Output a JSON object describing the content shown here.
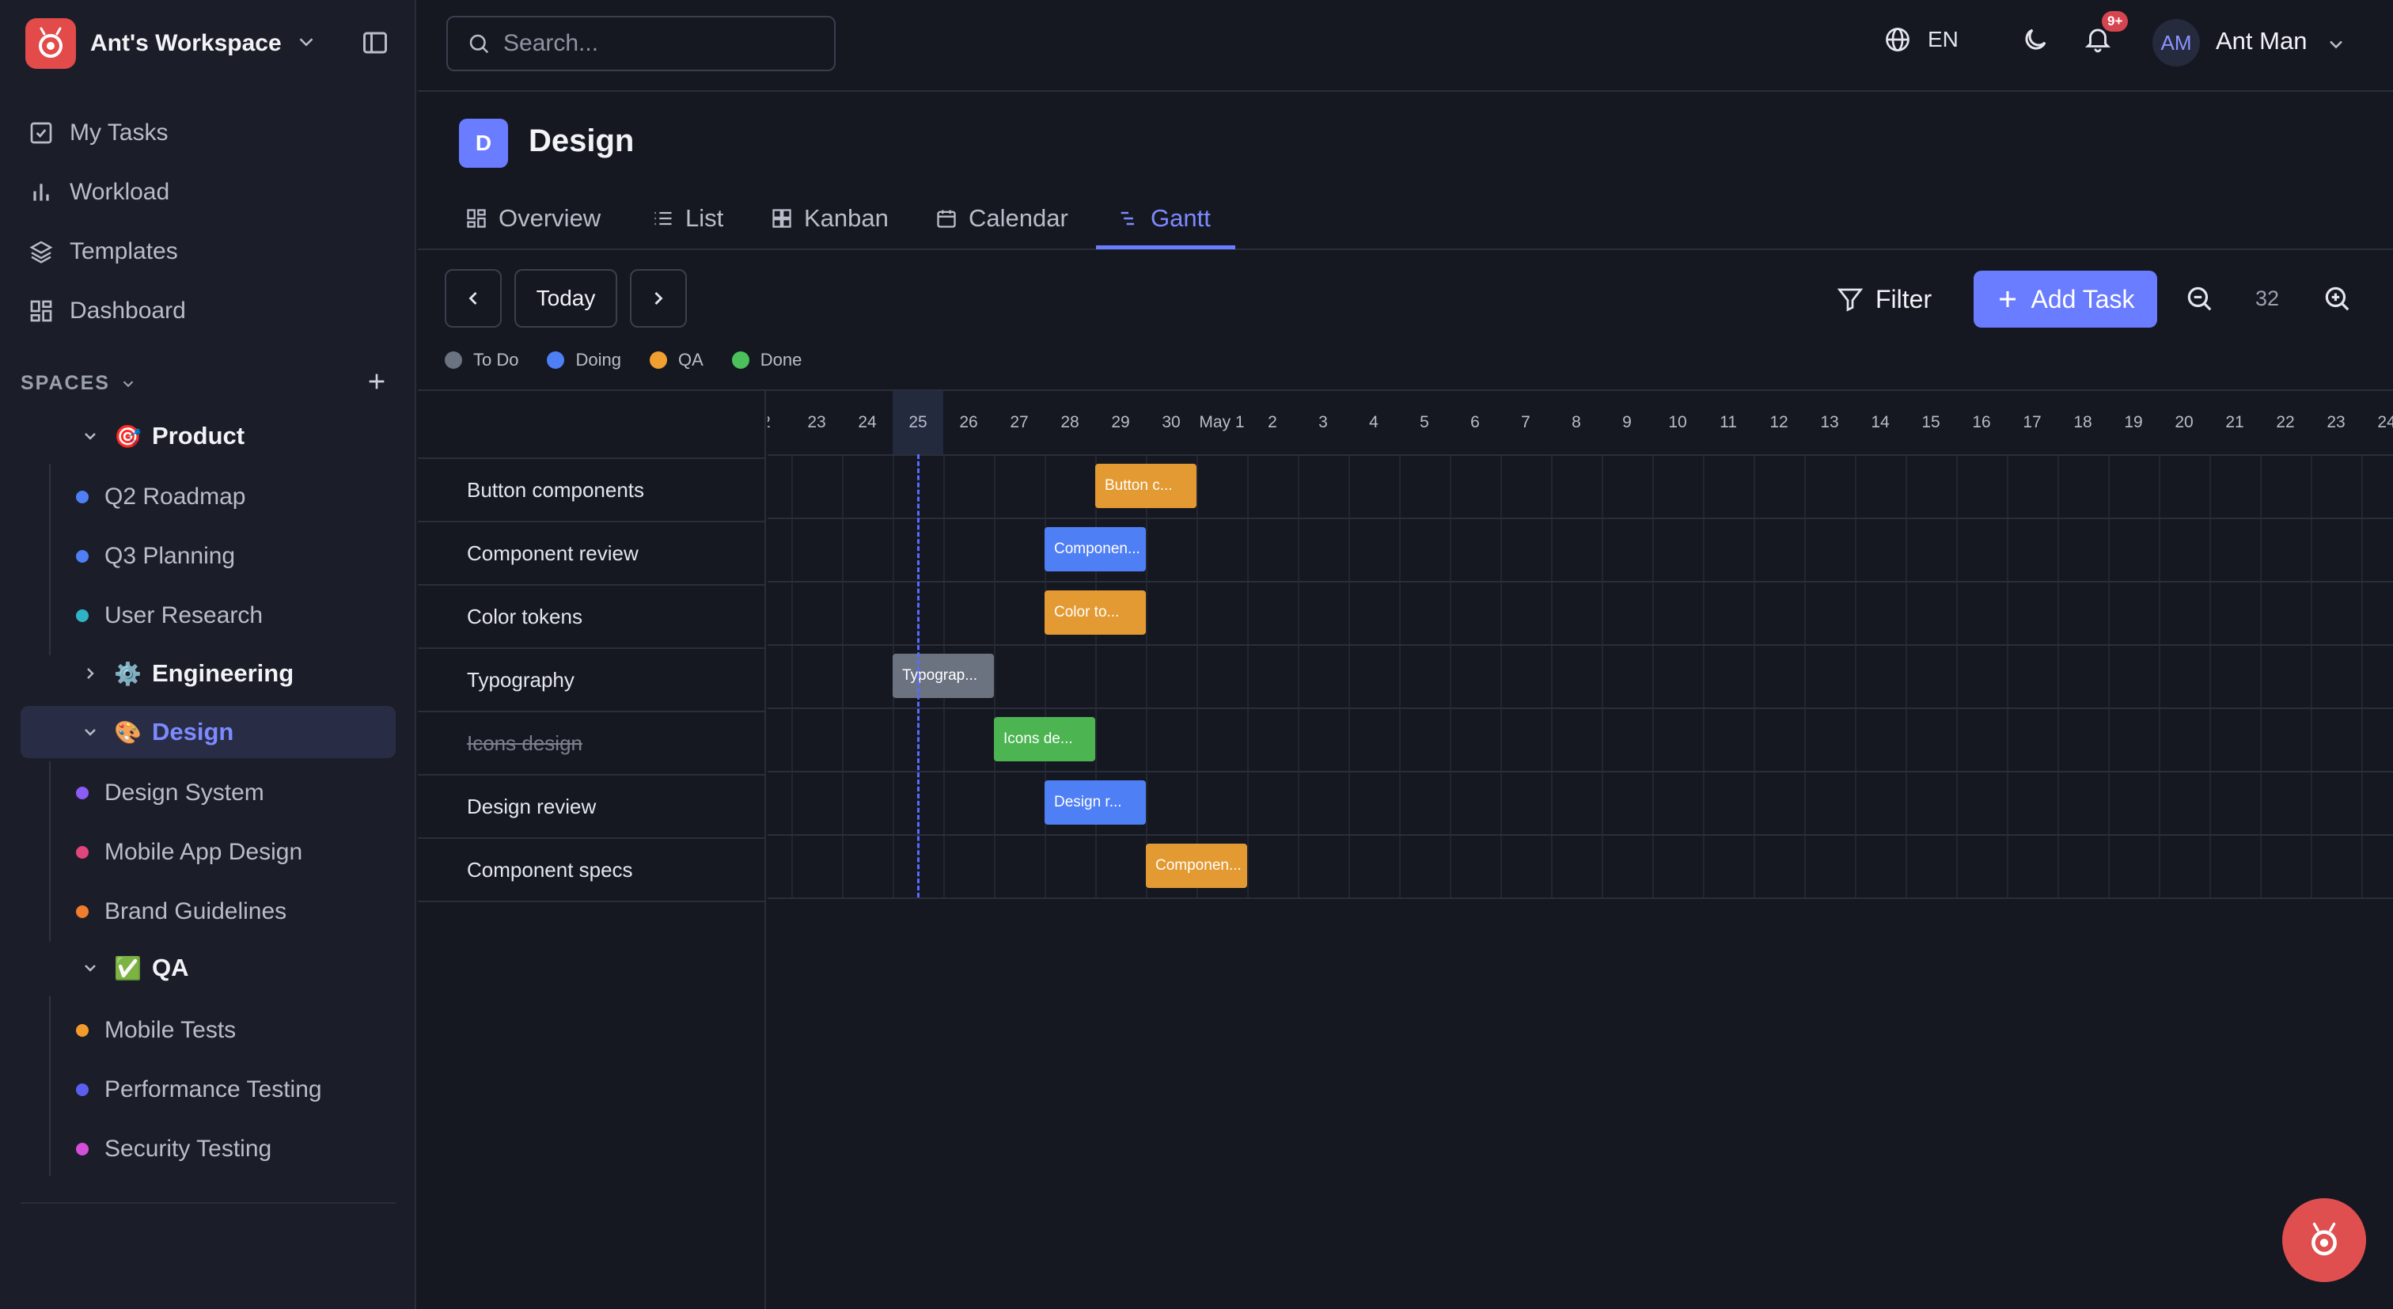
{
  "workspace": {
    "name": "Ant's Workspace"
  },
  "nav": [
    {
      "label": "My Tasks",
      "icon": "check-square-icon"
    },
    {
      "label": "Workload",
      "icon": "bar-chart-icon"
    },
    {
      "label": "Templates",
      "icon": "layers-icon"
    },
    {
      "label": "Dashboard",
      "icon": "dashboard-icon"
    }
  ],
  "spaces_label": "SPACES",
  "spaces": {
    "product": {
      "emoji": "🎯",
      "label": "Product"
    },
    "product_lists": [
      {
        "label": "Q2 Roadmap",
        "color": "#4f7ff5"
      },
      {
        "label": "Q3 Planning",
        "color": "#4f7ff5"
      },
      {
        "label": "User Research",
        "color": "#2fb3c6"
      }
    ],
    "engineering": {
      "emoji": "⚙️",
      "label": "Engineering"
    },
    "design": {
      "emoji": "🎨",
      "label": "Design"
    },
    "design_lists": [
      {
        "label": "Design System",
        "color": "#8b5cf6"
      },
      {
        "label": "Mobile App Design",
        "color": "#e0457b"
      },
      {
        "label": "Brand Guidelines",
        "color": "#f07d2e"
      }
    ],
    "qa": {
      "emoji": "✅",
      "label": "QA"
    },
    "qa_lists": [
      {
        "label": "Mobile Tests",
        "color": "#f39a2c"
      },
      {
        "label": "Performance Testing",
        "color": "#5b5ff0"
      },
      {
        "label": "Security Testing",
        "color": "#d34fd9"
      }
    ]
  },
  "search": {
    "placeholder": "Search..."
  },
  "topbar": {
    "lang": "EN",
    "badge": "9+",
    "avatar_initials": "AM",
    "user_name": "Ant Man"
  },
  "project": {
    "badge": "D",
    "title": "Design"
  },
  "tabs": [
    "Overview",
    "List",
    "Kanban",
    "Calendar",
    "Gantt"
  ],
  "active_tab": "Gantt",
  "toolbar": {
    "today": "Today",
    "filter": "Filter",
    "add_task": "Add Task",
    "zoom": "32"
  },
  "legend": [
    {
      "label": "To Do",
      "color": "#6b7280"
    },
    {
      "label": "Doing",
      "color": "#4f7ff5"
    },
    {
      "label": "QA",
      "color": "#f0a030"
    },
    {
      "label": "Done",
      "color": "#4cc05a"
    }
  ],
  "gantt": {
    "days": [
      "2",
      "23",
      "24",
      "25",
      "26",
      "27",
      "28",
      "29",
      "30",
      "May 1",
      "2",
      "3",
      "4",
      "5",
      "6",
      "7",
      "8",
      "9",
      "10",
      "11",
      "12",
      "13",
      "14",
      "15",
      "16",
      "17",
      "18",
      "19",
      "20",
      "21",
      "22",
      "23",
      "24"
    ],
    "today_label": "25",
    "tasks": [
      {
        "name": "Button components",
        "bar": "Button c...",
        "status": "QA",
        "start": "29",
        "end": "30",
        "color": "#e39a32"
      },
      {
        "name": "Component review",
        "bar": "Componen...",
        "status": "Doing",
        "start": "28",
        "end": "29",
        "color": "#4f7ff5"
      },
      {
        "name": "Color tokens",
        "bar": "Color to...",
        "status": "QA",
        "start": "28",
        "end": "29",
        "color": "#e39a32"
      },
      {
        "name": "Typography",
        "bar": "Typograp...",
        "status": "To Do",
        "start": "25",
        "end": "26",
        "color": "#6b7280"
      },
      {
        "name": "Icons design",
        "bar": "Icons de...",
        "status": "Done",
        "start": "27",
        "end": "28",
        "color": "#4cb552",
        "done": true
      },
      {
        "name": "Design review",
        "bar": "Design r...",
        "status": "Doing",
        "start": "28",
        "end": "29",
        "color": "#4f7ff5"
      },
      {
        "name": "Component specs",
        "bar": "Componen...",
        "status": "QA",
        "start": "30",
        "end": "May 1",
        "color": "#e39a32"
      }
    ]
  }
}
